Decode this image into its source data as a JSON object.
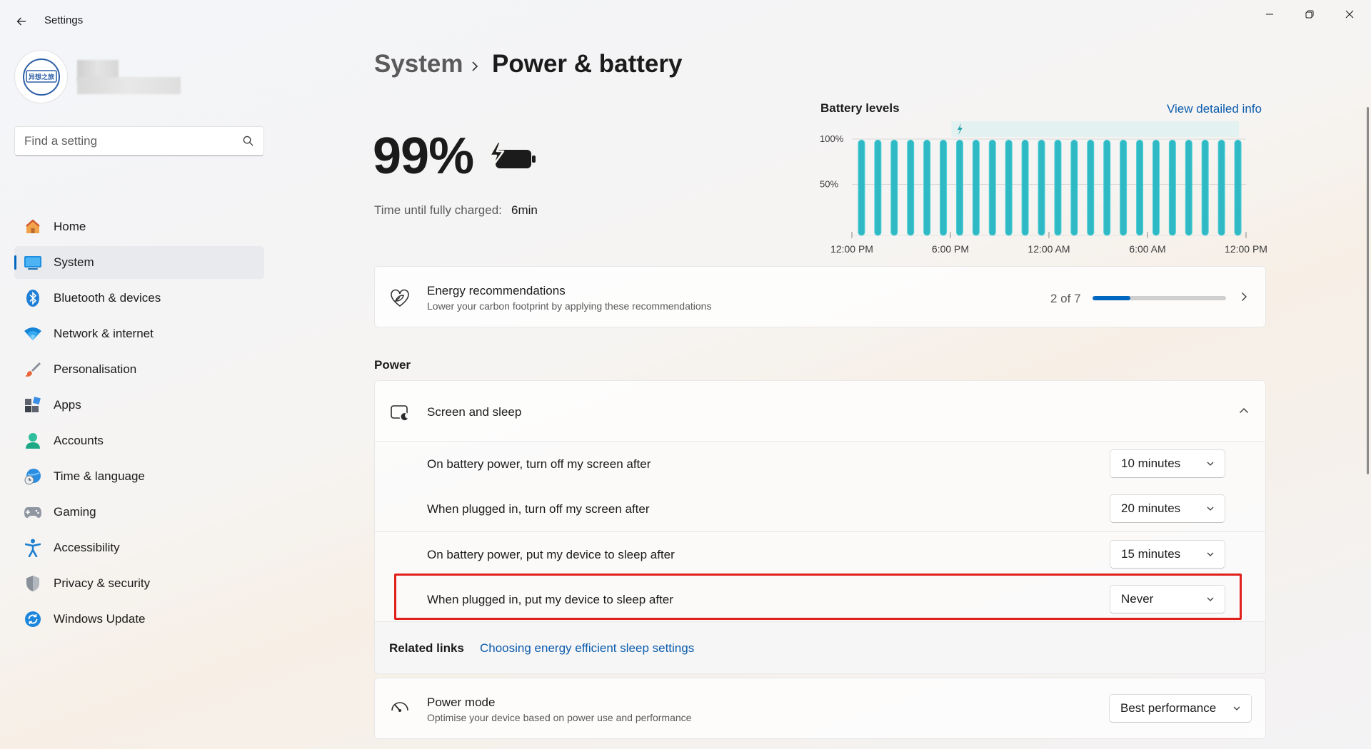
{
  "window": {
    "title": "Settings"
  },
  "search": {
    "placeholder": "Find a setting"
  },
  "avatar_text": "异想之旅",
  "nav": [
    {
      "label": "Home",
      "icon": "home-icon"
    },
    {
      "label": "System",
      "icon": "system-icon",
      "active": true
    },
    {
      "label": "Bluetooth & devices",
      "icon": "bluetooth-icon"
    },
    {
      "label": "Network & internet",
      "icon": "wifi-icon"
    },
    {
      "label": "Personalisation",
      "icon": "brush-icon"
    },
    {
      "label": "Apps",
      "icon": "apps-icon"
    },
    {
      "label": "Accounts",
      "icon": "person-icon"
    },
    {
      "label": "Time & language",
      "icon": "globe-clock-icon"
    },
    {
      "label": "Gaming",
      "icon": "gamepad-icon"
    },
    {
      "label": "Accessibility",
      "icon": "accessibility-icon"
    },
    {
      "label": "Privacy & security",
      "icon": "shield-icon"
    },
    {
      "label": "Windows Update",
      "icon": "update-icon"
    }
  ],
  "breadcrumb": {
    "root": "System",
    "current": "Power & battery"
  },
  "battery": {
    "percent": "99%",
    "charge_label": "Time until fully charged:",
    "charge_value": "6min"
  },
  "battery_levels": {
    "title": "Battery levels",
    "link": "View detailed info"
  },
  "chart_data": {
    "type": "bar",
    "title": "Battery levels",
    "y_ticks": [
      "100%",
      "50%"
    ],
    "x_ticks": [
      "12:00 PM",
      "6:00 PM",
      "12:00 AM",
      "6:00 AM",
      "12:00 PM"
    ],
    "ylim": [
      0,
      100
    ],
    "values": [
      99,
      99,
      99,
      99,
      99,
      99,
      99,
      99,
      99,
      99,
      99,
      99,
      99,
      99,
      99,
      99,
      99,
      99,
      99,
      99,
      99,
      99,
      99,
      99
    ],
    "charging_marker_index": 6,
    "colors": {
      "bar": "#2fb9c4",
      "bar_edge": "#4fcfd6",
      "charging_band": "#e3f1f1"
    }
  },
  "energy": {
    "title": "Energy recommendations",
    "subtitle": "Lower your carbon footprint by applying these recommendations",
    "count": "2 of 7",
    "progress": 0.2857
  },
  "power": {
    "heading": "Power",
    "screen_sleep": {
      "title": "Screen and sleep",
      "rows": [
        {
          "label": "On battery power, turn off my screen after",
          "value": "10 minutes"
        },
        {
          "label": "When plugged in, turn off my screen after",
          "value": "20 minutes"
        },
        {
          "label": "On battery power, put my device to sleep after",
          "value": "15 minutes"
        },
        {
          "label": "When plugged in, put my device to sleep after",
          "value": "Never"
        }
      ]
    },
    "related": {
      "label": "Related links",
      "link": "Choosing energy efficient sleep settings"
    },
    "mode": {
      "title": "Power mode",
      "subtitle": "Optimise your device based on power use and performance",
      "value": "Best performance"
    }
  },
  "colors": {
    "accent": "#0067c0",
    "link": "#0b5cad",
    "highlight": "#e0201a"
  }
}
